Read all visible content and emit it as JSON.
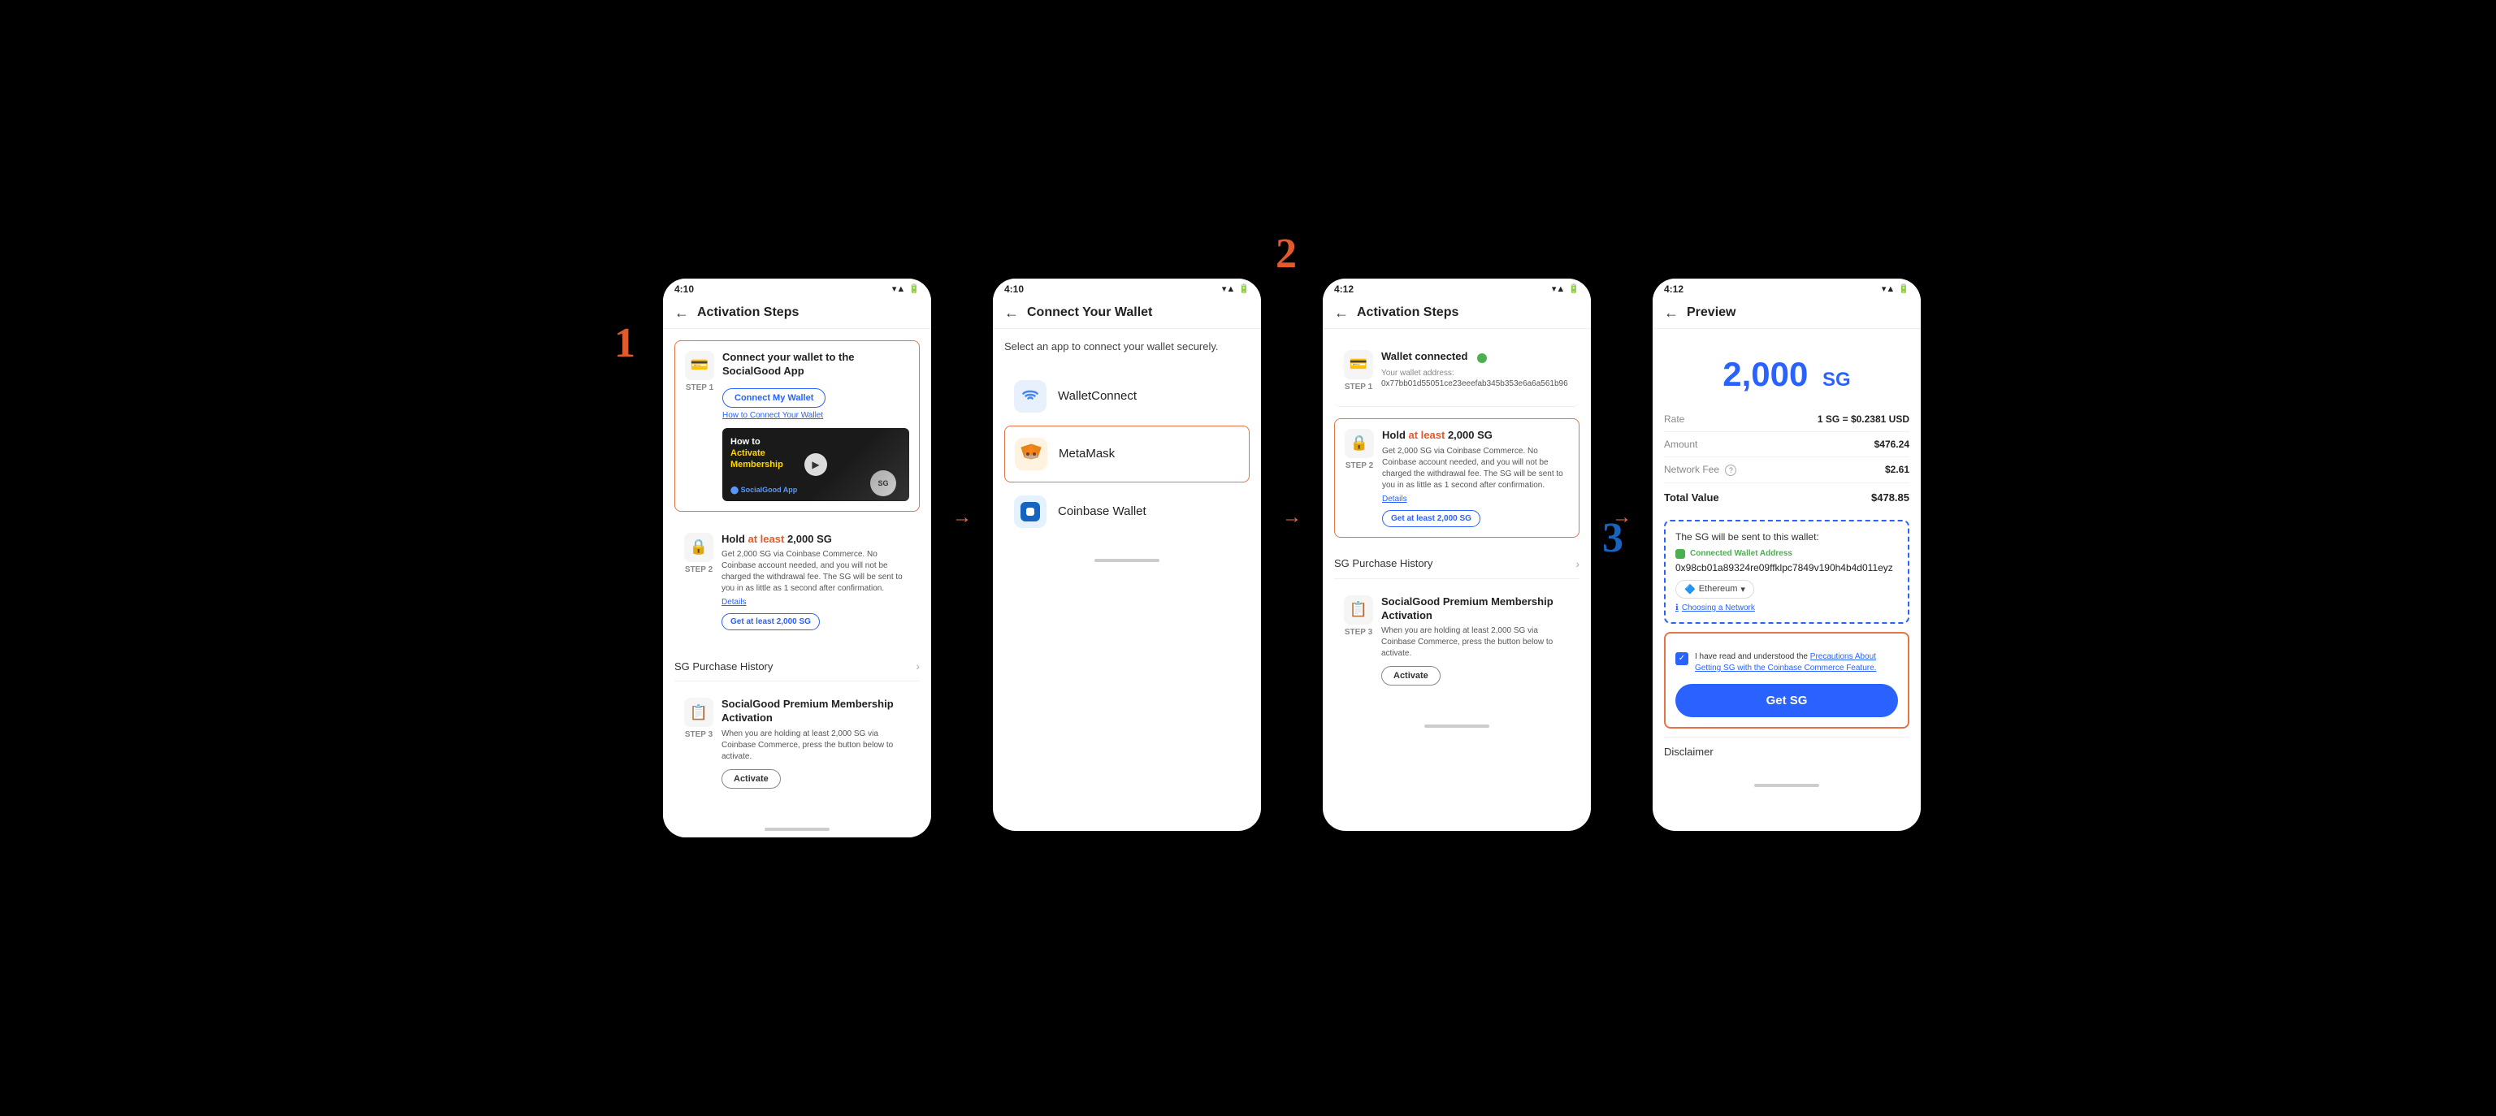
{
  "scene": {
    "step_numbers": [
      "1",
      "2",
      "3"
    ],
    "arrow_chars": [
      "→",
      "→"
    ]
  },
  "phone1": {
    "status_time": "4:10",
    "status_icons": "▾ ▲ 🔋",
    "title": "Activation Steps",
    "step1": {
      "label": "STEP 1",
      "icon": "💳",
      "title": "Connect your wallet to the SocialGood App",
      "btn": "Connect My Wallet",
      "link": "How to Connect Your Wallet",
      "video_line1": "How to",
      "video_line2": "Activate",
      "video_line3": "Membership",
      "logo_text": "⬤ SocialGood App"
    },
    "step2": {
      "label": "STEP 2",
      "icon": "🔒",
      "title_start": "Hold ",
      "title_highlight": "at least",
      "title_amount": " 2,000 SG",
      "desc": "Get 2,000 SG via Coinbase Commerce. No Coinbase account needed, and you will not be charged the withdrawal fee. The SG will be sent to you in as little as 1 second after confirmation.",
      "link": "Details",
      "btn": "Get at least 2,000 SG"
    },
    "history_label": "SG Purchase History",
    "step3": {
      "label": "STEP 3",
      "icon": "📋",
      "title": "SocialGood Premium Membership Activation",
      "desc": "When you are holding at least 2,000 SG via Coinbase Commerce, press the button below to activate.",
      "btn": "Activate"
    }
  },
  "phone2": {
    "status_time": "4:10",
    "title": "Connect Your Wallet",
    "subtitle": "Select an app to connect your wallet securely.",
    "wallets": [
      {
        "id": "walletconnect",
        "name": "WalletConnect",
        "icon": "〜",
        "selected": false
      },
      {
        "id": "metamask",
        "name": "MetaMask",
        "icon": "🦊",
        "selected": true
      },
      {
        "id": "coinbase",
        "name": "Coinbase Wallet",
        "icon": "◉",
        "selected": false
      }
    ]
  },
  "phone3": {
    "status_time": "4:12",
    "title": "Activation Steps",
    "step1": {
      "label": "STEP 1",
      "icon": "💳",
      "title": "Wallet connected",
      "connected_label": "Your wallet address:",
      "address": "0x77bb01d55051ce23eeefab345b353e6a6a561b96"
    },
    "step2": {
      "label": "STEP 2",
      "icon": "🔒",
      "title_start": "Hold ",
      "title_highlight": "at least",
      "title_amount": " 2,000 SG",
      "desc": "Get 2,000 SG via Coinbase Commerce. No Coinbase account needed, and you will not be charged the withdrawal fee. The SG will be sent to you in as little as 1 second after confirmation.",
      "link": "Details",
      "btn": "Get at least 2,000 SG"
    },
    "history_label": "SG Purchase History",
    "step3": {
      "label": "STEP 3",
      "icon": "📋",
      "title": "SocialGood Premium Membership Activation",
      "desc": "When you are holding at least 2,000 SG via Coinbase Commerce, press the button below to activate.",
      "btn": "Activate"
    }
  },
  "phone4": {
    "status_time": "4:12",
    "title": "Preview",
    "amount": "2,000",
    "amount_unit": "SG",
    "rate_label": "Rate",
    "rate_value": "1 SG = $0.2381 USD",
    "amount_label": "Amount",
    "amount_value": "$476.24",
    "fee_label": "Network Fee",
    "fee_value": "$2.61",
    "total_label": "Total Value",
    "total_value": "$478.85",
    "wallet_section_title": "The SG will be sent to this wallet:",
    "connected_address_label": "Connected Wallet Address",
    "wallet_address": "0x98cb01a89324re09ffklpc7849v190h4b4d011eyz",
    "network_label": "Ethereum",
    "choosing_network": "Choosing a Network",
    "checkbox_text": "I have read and understood the Precautions About Getting SG with the Coinbase Commerce Feature.",
    "get_sg_btn": "Get SG",
    "disclaimer": "Disclaimer"
  }
}
